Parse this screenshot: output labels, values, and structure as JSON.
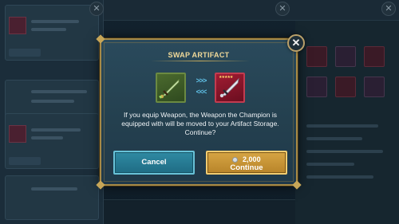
{
  "modal": {
    "title": "SWAP ARTIFACT",
    "message": "If you equip Weapon, the Weapon the Champion is equipped with will be moved to your Artifact Storage. Continue?",
    "current_artifact": {
      "icon": "green-sword-icon",
      "stars_text": "",
      "frame_color": "#6b8a42"
    },
    "new_artifact": {
      "icon": "red-sword-icon",
      "stars_text": "★★★★★",
      "frame_color": "#c23c50"
    },
    "swap_arrows": {
      "right": ">>>",
      "left": "<<<"
    },
    "cancel_label": "Cancel",
    "continue_label": "Continue",
    "cost_value": "2,000",
    "cost_icon": "silver-coin-icon",
    "close_icon": "close-icon",
    "colors": {
      "frame_gold": "#a88a46",
      "title_gold": "#f0d999",
      "cancel_blue": "#2f8aa3",
      "continue_gold": "#d6a544"
    }
  }
}
